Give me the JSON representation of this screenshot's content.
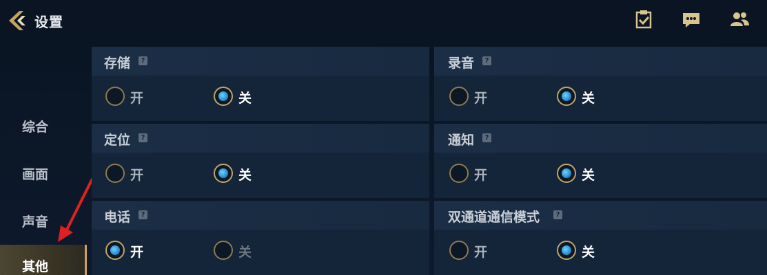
{
  "header": {
    "title": "设置",
    "icons": [
      "back-arrow-icon",
      "clipboard-check-icon",
      "chat-bubble-icon",
      "friends-icon"
    ]
  },
  "sidebar": {
    "items": [
      {
        "label": "综合",
        "active": false
      },
      {
        "label": "画面",
        "active": false
      },
      {
        "label": "声音",
        "active": false
      },
      {
        "label": "其他",
        "active": true
      }
    ]
  },
  "panels": [
    {
      "title": "存储",
      "help": "?",
      "options": [
        {
          "label": "开",
          "selected": false
        },
        {
          "label": "关",
          "selected": true
        }
      ]
    },
    {
      "title": "录音",
      "help": "?",
      "options": [
        {
          "label": "开",
          "selected": false
        },
        {
          "label": "关",
          "selected": true
        }
      ]
    },
    {
      "title": "定位",
      "help": "?",
      "options": [
        {
          "label": "开",
          "selected": false
        },
        {
          "label": "关",
          "selected": true
        }
      ]
    },
    {
      "title": "通知",
      "help": "?",
      "options": [
        {
          "label": "开",
          "selected": false
        },
        {
          "label": "关",
          "selected": true
        }
      ]
    },
    {
      "title": "电话",
      "help": "?",
      "options": [
        {
          "label": "开",
          "selected": true
        },
        {
          "label": "关",
          "selected": false
        }
      ]
    },
    {
      "title": "双通道通信模式",
      "help": "?",
      "options": [
        {
          "label": "开",
          "selected": false
        },
        {
          "label": "关",
          "selected": true
        }
      ]
    }
  ],
  "colors": {
    "accent_gold": "#c8a35a",
    "radio_selected": "#2a8fd0",
    "annotation_arrow": "#e02020"
  }
}
